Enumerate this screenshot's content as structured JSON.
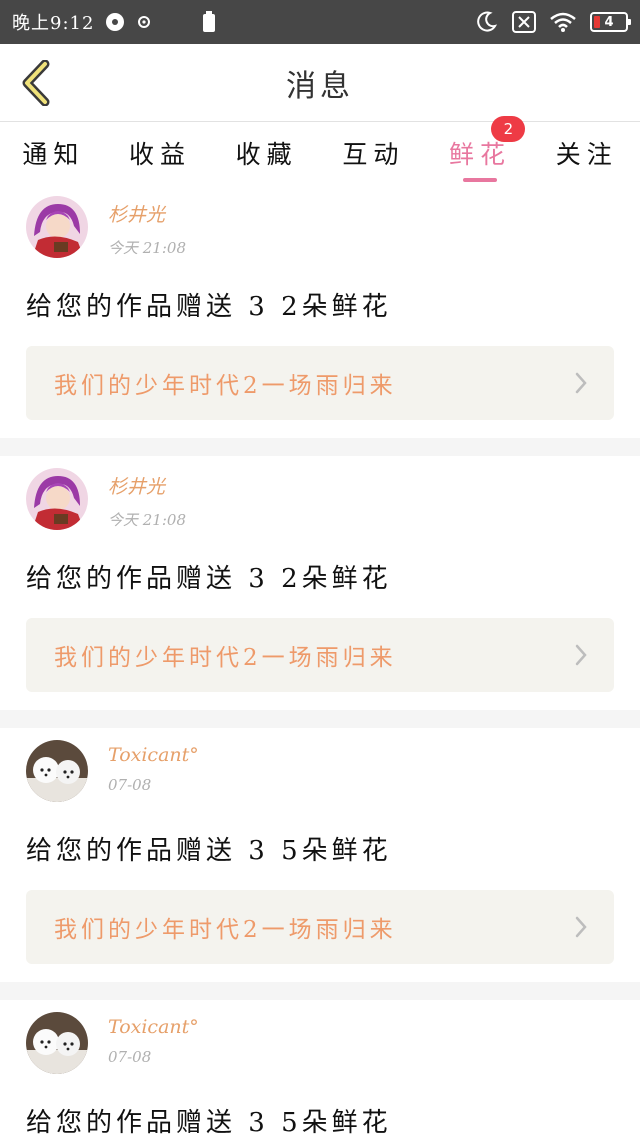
{
  "status_bar": {
    "time": "晚上9:12",
    "battery_level": "4"
  },
  "header": {
    "title": "消息"
  },
  "tabs": [
    {
      "label": "通知"
    },
    {
      "label": "收益"
    },
    {
      "label": "收藏"
    },
    {
      "label": "互动"
    },
    {
      "label": "鲜花",
      "badge": "2",
      "active": true
    },
    {
      "label": "关注"
    }
  ],
  "feed": [
    {
      "username": "杉井光",
      "time": "今天 21:08",
      "message": "给您的作品赠送 3 2朵鲜花",
      "work_title": "我们的少年时代2一场雨归来",
      "avatar": "anime-girl-avatar"
    },
    {
      "username": "杉井光",
      "time": "今天 21:08",
      "message": "给您的作品赠送 3 2朵鲜花",
      "work_title": "我们的少年时代2一场雨归来",
      "avatar": "anime-girl-avatar"
    },
    {
      "username": "Toxicant°",
      "time": "07-08",
      "message": "给您的作品赠送 3 5朵鲜花",
      "work_title": "我们的少年时代2一场雨归来",
      "avatar": "puppies-avatar"
    },
    {
      "username": "Toxicant°",
      "time": "07-08",
      "message": "给您的作品赠送 3 5朵鲜花",
      "work_title": "",
      "avatar": "puppies-avatar"
    }
  ],
  "colors": {
    "accent_pink": "#e8779f",
    "username_orange": "#e6a06a",
    "work_title_orange": "#ee9a6a",
    "badge_red": "#ee3b45"
  }
}
